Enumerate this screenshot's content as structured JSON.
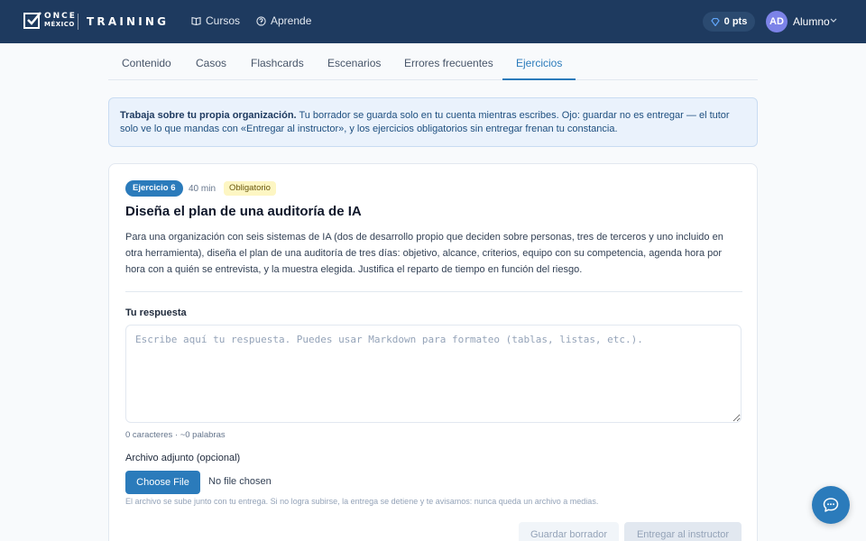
{
  "brand": {
    "logo_top": "ONCE",
    "logo_bottom": "MÉXICO",
    "product": "TRAINING"
  },
  "nav": {
    "cursos": "Cursos",
    "aprende": "Aprende"
  },
  "user": {
    "points": "0 pts",
    "initials": "AD",
    "name": "Alumno"
  },
  "tabs": [
    {
      "label": "Contenido"
    },
    {
      "label": "Casos"
    },
    {
      "label": "Flashcards"
    },
    {
      "label": "Escenarios"
    },
    {
      "label": "Errores frecuentes"
    },
    {
      "label": "Ejercicios",
      "active": true
    }
  ],
  "notice": {
    "bold": "Trabaja sobre tu propia organización.",
    "text": " Tu borrador se guarda solo en tu cuenta mientras escribes. Ojo: guardar no es entregar — el tutor solo ve lo que mandas con «Entregar al instructor», y los ejercicios obligatorios sin entregar frenan tu constancia."
  },
  "exercise": {
    "badge": "Ejercicio 6",
    "duration": "40 min",
    "tag": "Obligatorio",
    "title": "Diseña el plan de una auditoría de IA",
    "description": "Para una organización con seis sistemas de IA (dos de desarrollo propio que deciden sobre personas, tres de terceros y uno incluido en otra herramienta), diseña el plan de una auditoría de tres días: objetivo, alcance, criterios, equipo con su competencia, agenda hora por hora con a quién se entrevista, y la muestra elegida. Justifica el reparto de tiempo en función del riesgo."
  },
  "answer": {
    "label": "Tu respuesta",
    "placeholder": "Escribe aquí tu respuesta. Puedes usar Markdown para formateo (tablas, listas, etc.).",
    "value": "",
    "count": "0 caracteres · ~0 palabras"
  },
  "attachment": {
    "label": "Archivo adjunto (opcional)",
    "button": "Choose File",
    "status": "No file chosen",
    "help": "El archivo se sube junto con tu entrega. Si no logra subirse, la entrega se detiene y te avisamos: nunca queda un archivo a medias."
  },
  "actions": {
    "draft": "Guardar borrador",
    "submit": "Entregar al instructor"
  },
  "colors": {
    "topbar": "#1e3a5f",
    "accent": "#2b7bbb",
    "avatar": "#7c83e8"
  }
}
